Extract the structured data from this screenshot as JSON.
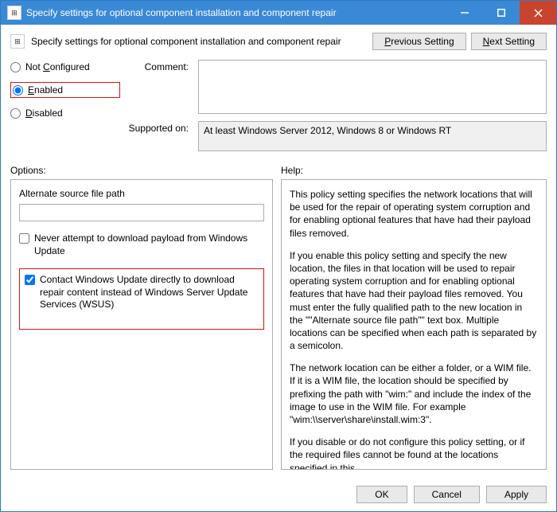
{
  "window": {
    "title": "Specify settings for optional component installation and component repair"
  },
  "header": {
    "heading": "Specify settings for optional component installation and component repair",
    "previous": "Previous Setting",
    "previous_ul": "P",
    "next": "Next Setting",
    "next_ul": "N"
  },
  "radios": {
    "not_configured": "Not Configured",
    "not_configured_ul": "C",
    "enabled": "Enabled",
    "enabled_ul": "E",
    "disabled": "Disabled",
    "disabled_ul": "D",
    "selected": "enabled"
  },
  "labels": {
    "comment": "Comment:",
    "supported": "Supported on:",
    "options": "Options:",
    "help": "Help:"
  },
  "comment": "",
  "supported": "At least Windows Server 2012, Windows 8 or Windows RT",
  "options": {
    "alt_path_label": "Alternate source file path",
    "alt_path_value": "",
    "never_download": "Never attempt to download payload from Windows Update",
    "never_download_checked": false,
    "contact_wu": "Contact Windows Update directly to download repair content instead of Windows Server Update Services (WSUS)",
    "contact_wu_checked": true
  },
  "help": {
    "p1": "This policy setting specifies the network locations that will be used for the repair of operating system corruption and for enabling optional features that have had their payload files removed.",
    "p2": "If you enable this policy setting and specify the new location, the files in that location will be used to repair operating system corruption and for enabling optional features that have had their payload files removed. You must enter the fully qualified path to the new location in the \"\"Alternate source file path\"\" text box. Multiple locations can be specified when each path is separated by a semicolon.",
    "p3": "The network location can be either a folder, or a WIM file. If it is a WIM file, the location should be specified by prefixing the path with \"wim:\" and include the index of the image to use in the WIM file. For example \"wim:\\\\server\\share\\install.wim:3\".",
    "p4": "If you disable or do not configure this policy setting, or if the required files cannot be found at the locations specified in this"
  },
  "footer": {
    "ok": "OK",
    "cancel": "Cancel",
    "apply": "Apply"
  }
}
